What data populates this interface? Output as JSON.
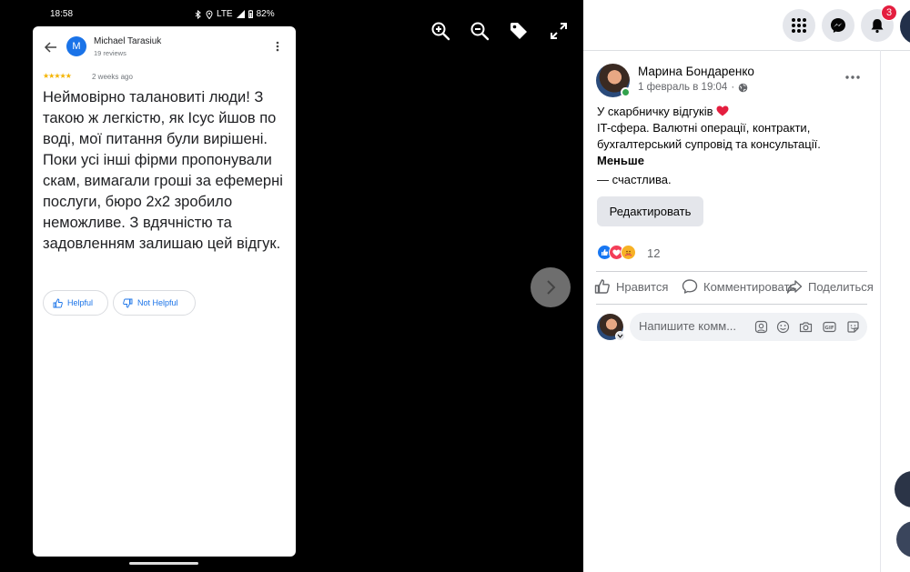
{
  "viewer": {
    "status": {
      "time": "18:58",
      "network": "LTE",
      "battery": "82%"
    },
    "tools": [
      "zoom-in-icon",
      "zoom-out-icon",
      "tag-icon",
      "fullscreen-icon"
    ],
    "review": {
      "avatar_letter": "M",
      "reviewer": "Michael Tarasiuk",
      "review_count": "19 reviews",
      "stars": "★★★★★",
      "date": "2 weeks ago",
      "text": "Неймовірно талановиті люди! З такою ж легкістю, як Ісус йшов по воді, мої питання були вирішені. Поки усі інші фірми пропонували скам, вимагали гроші за ефемерні послуги, бюро 2x2 зробило неможливе. З вдячністю та задовленням залишаю цей відгук.",
      "helpful": "Helpful",
      "not_helpful": "Not Helpful"
    }
  },
  "header": {
    "notification_count": "3"
  },
  "post": {
    "author": "Марина Бондаренко",
    "time": "1 февраль в 19:04",
    "body_line1": "У скарбничку відгуків",
    "body_line2": "IT-сфера. Валютні операції, контракти, бухгалтерський супровід та консультації.",
    "see_less": "Меньше",
    "feeling": "—  счастлива.",
    "edit_label": "Редактировать",
    "reaction_count": "12",
    "actions": {
      "like": "Нравится",
      "comment": "Комментировать",
      "share": "Поделиться"
    },
    "comment_placeholder": "Напишите комм..."
  },
  "colors": {
    "facebook_blue": "#1877f2",
    "google_blue": "#1a73e8",
    "star_yellow": "#f4b400",
    "badge_red": "#e41e3f",
    "online_green": "#31a24c"
  }
}
